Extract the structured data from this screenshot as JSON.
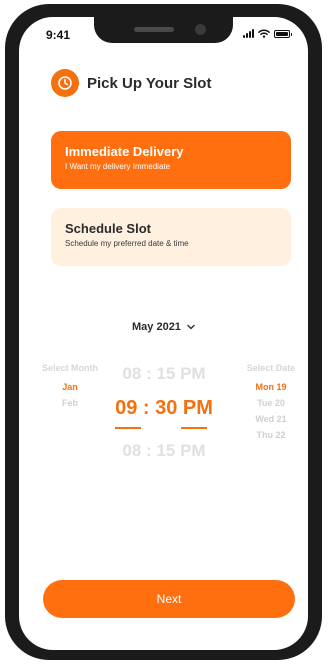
{
  "status_bar": {
    "time": "9:41",
    "icons": [
      "signal-icon",
      "wifi-icon",
      "battery-icon"
    ]
  },
  "header": {
    "icon": "clock-icon",
    "title": "Pick Up Your Slot"
  },
  "options": [
    {
      "title": "Immediate Delivery",
      "subtitle": "I Want my delivery Immediate",
      "selected": true
    },
    {
      "title": "Schedule Slot",
      "subtitle": "Schedule my preferred date & time",
      "selected": false
    }
  ],
  "picker": {
    "month_year": "May 2021",
    "month_label": "Select Month",
    "months": [
      "Jan",
      "Feb"
    ],
    "selected_month": "Jan",
    "times": [
      "08 : 15 PM",
      "09 : 30 PM",
      "08 : 15 PM"
    ],
    "selected_time": "09 : 30 PM",
    "date_label": "Select Date",
    "dates": [
      "Mon 19",
      "Tue 20",
      "Wed 21",
      "Thu 22"
    ],
    "selected_date": "Mon 19"
  },
  "footer": {
    "next_label": "Next"
  },
  "colors": {
    "accent": "#ff6f0f",
    "accent_light": "#fff0e0",
    "text_dark": "#2b2b2b",
    "disabled": "#d0d0d0"
  }
}
